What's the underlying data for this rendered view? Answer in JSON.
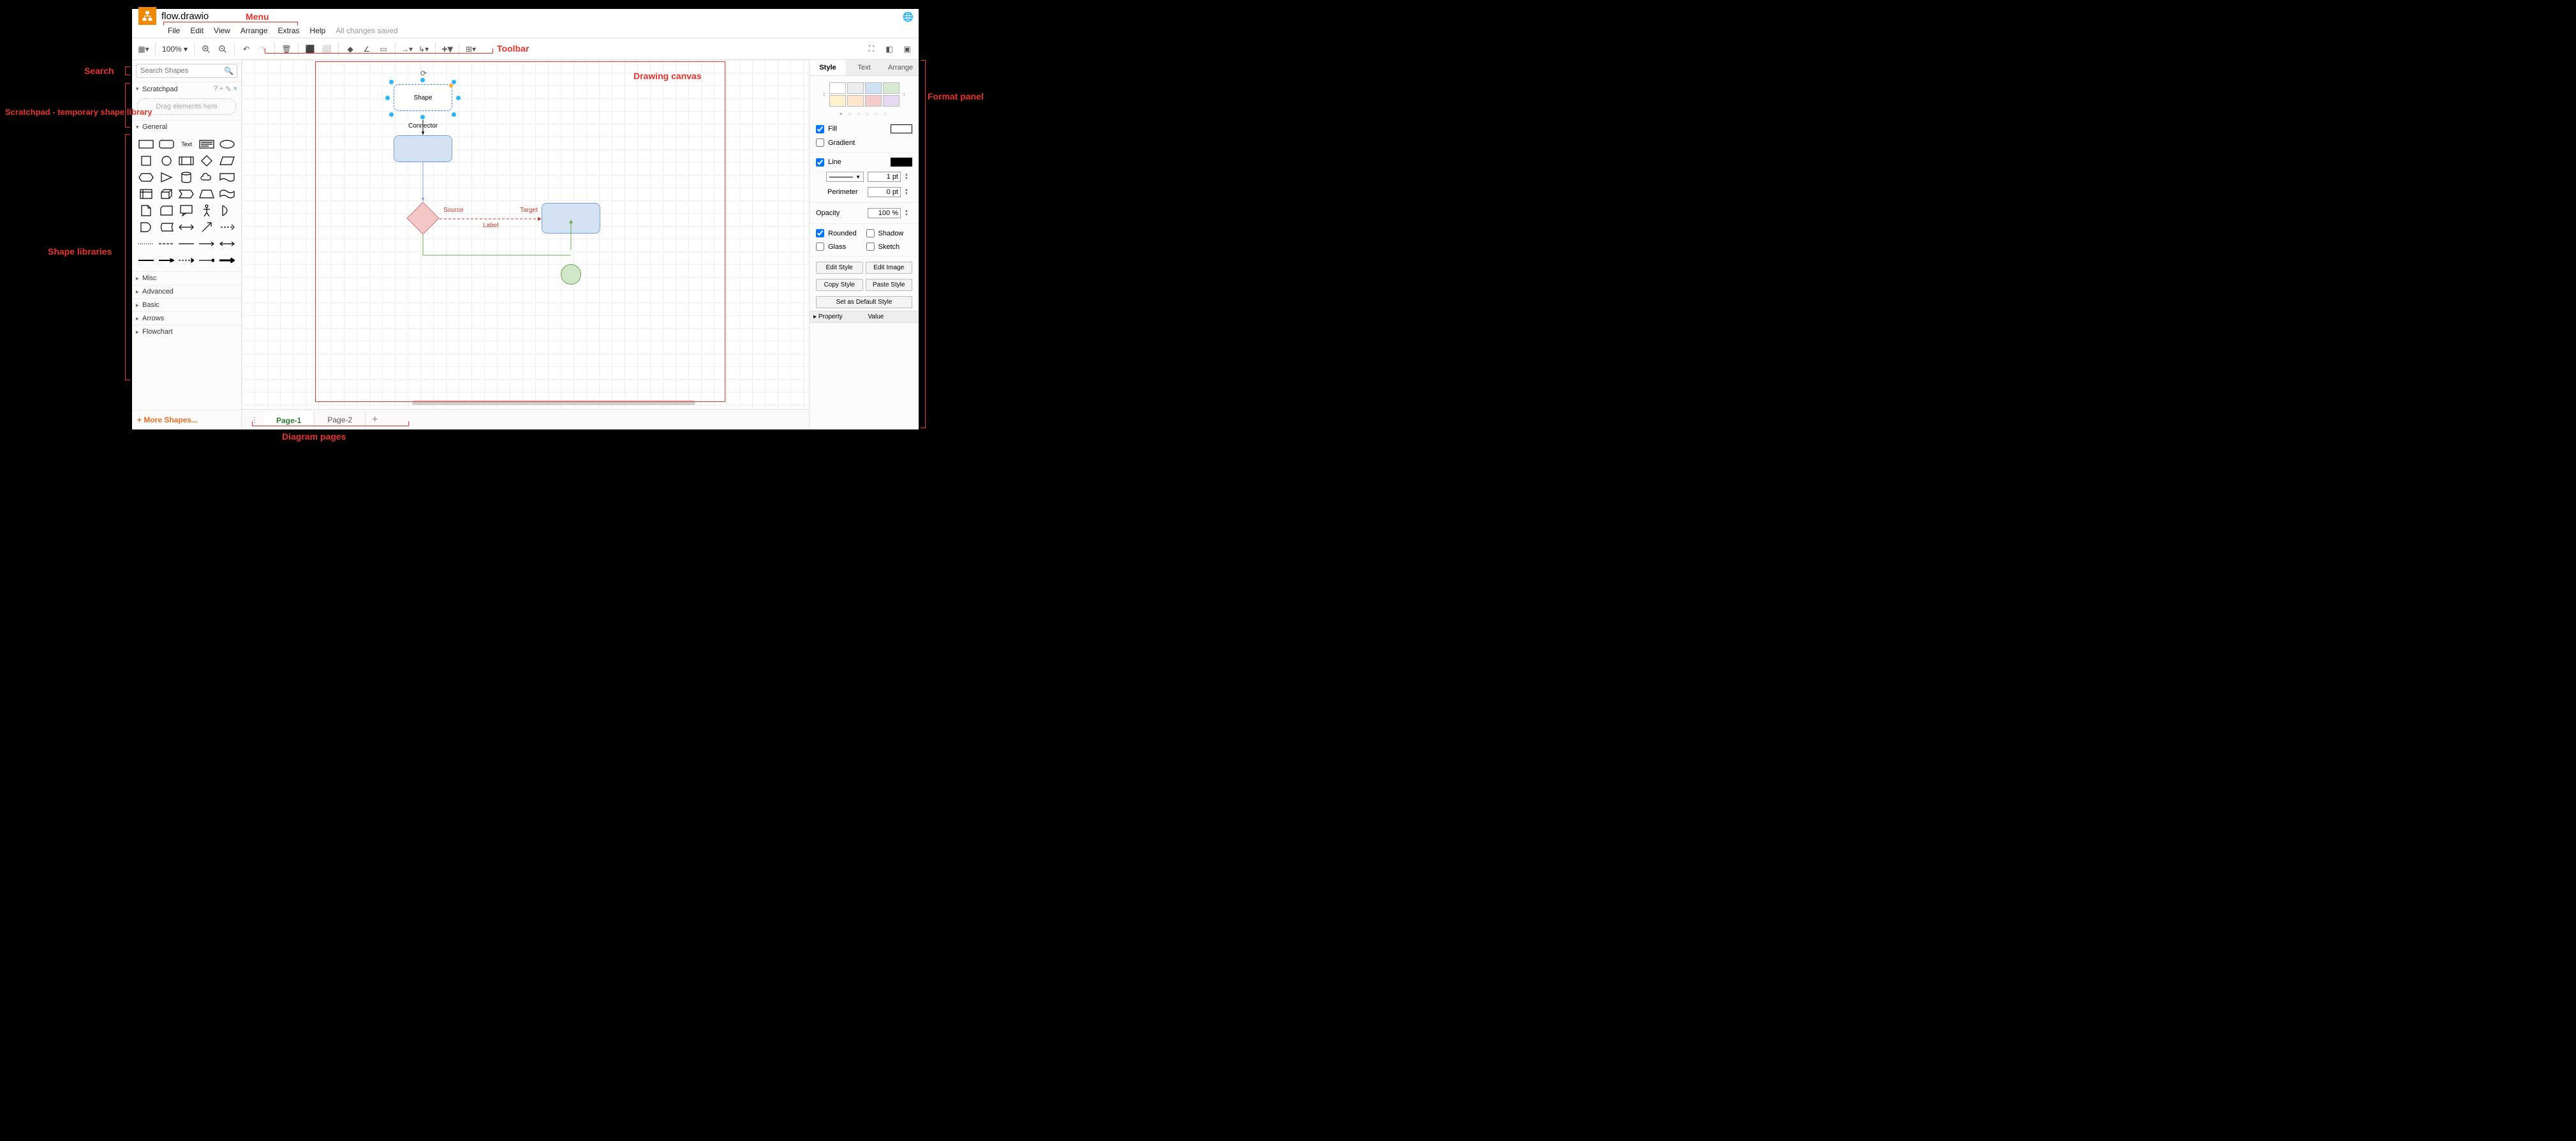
{
  "filename": "flow.drawio",
  "menu": {
    "items": [
      "File",
      "Edit",
      "View",
      "Arrange",
      "Extras",
      "Help"
    ],
    "status": "All changes saved"
  },
  "toolbar": {
    "zoom": "100%"
  },
  "sidebar": {
    "search_placeholder": "Search Shapes",
    "scratchpad_label": "Scratchpad",
    "scratchpad_drop": "Drag elements here",
    "sections": [
      "General",
      "Misc",
      "Advanced",
      "Basic",
      "Arrows",
      "Flowchart"
    ],
    "more_shapes": "+ More Shapes..."
  },
  "canvas": {
    "shape_label": "Shape",
    "connector_label": "Connector",
    "source_label": "Source",
    "target_label": "Target",
    "label_label": "Label"
  },
  "pages": {
    "tabs": [
      "Page-1",
      "Page-2"
    ],
    "active": 0
  },
  "format": {
    "tabs": [
      "Style",
      "Text",
      "Arrange"
    ],
    "fill_label": "Fill",
    "gradient_label": "Gradient",
    "line_label": "Line",
    "line_width": "1 pt",
    "perimeter_label": "Perimeter",
    "perimeter_value": "0 pt",
    "opacity_label": "Opacity",
    "opacity_value": "100 %",
    "rounded_label": "Rounded",
    "shadow_label": "Shadow",
    "glass_label": "Glass",
    "sketch_label": "Sketch",
    "edit_style": "Edit Style",
    "edit_image": "Edit Image",
    "copy_style": "Copy Style",
    "paste_style": "Paste Style",
    "set_default": "Set as Default Style",
    "property_hdr": "Property",
    "value_hdr": "Value",
    "swatches1": [
      "#ffffff",
      "#e0e0e0",
      "#cfe2f3",
      "#d9ead3"
    ],
    "swatches2": [
      "#fff2cc",
      "#ffe6b3",
      "#f4cccc",
      "#e6d9f2"
    ]
  },
  "annotations": {
    "menu": "Menu",
    "toolbar": "Toolbar",
    "search": "Search",
    "scratchpad": "Scratchpad - temporary shape library",
    "shape_libs": "Shape libraries",
    "canvas": "Drawing canvas",
    "format": "Format panel",
    "pages": "Diagram pages"
  }
}
